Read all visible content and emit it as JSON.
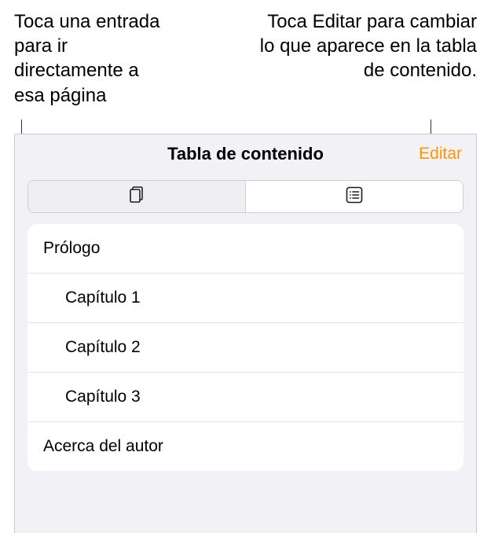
{
  "callouts": {
    "left": "Toca una entrada para ir directamente a esa página",
    "right": "Toca Editar para cambiar lo que aparece en la tabla de contenido."
  },
  "panel": {
    "title": "Tabla de contenido",
    "edit_label": "Editar"
  },
  "segments": {
    "thumbnails_name": "thumbnails-view",
    "toc_name": "toc-view"
  },
  "toc": [
    {
      "label": "Prólogo",
      "indent": false
    },
    {
      "label": "Capítulo 1",
      "indent": true
    },
    {
      "label": "Capítulo 2",
      "indent": true
    },
    {
      "label": "Capítulo 3",
      "indent": true
    },
    {
      "label": "Acerca del autor",
      "indent": false
    }
  ],
  "colors": {
    "accent": "#ff9500",
    "panel_bg": "#f2f2f6"
  }
}
